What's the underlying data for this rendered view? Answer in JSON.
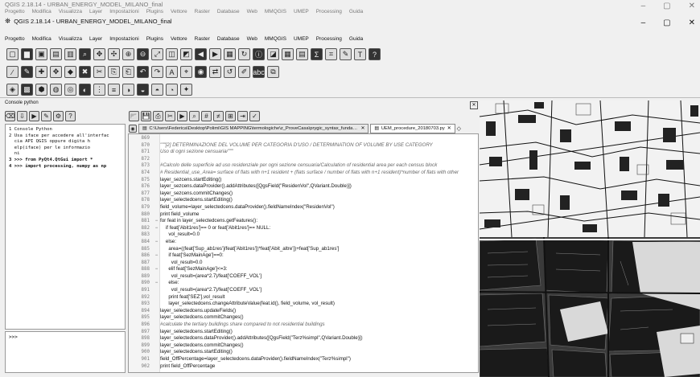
{
  "window": {
    "title": "QGIS 2.18.14 - URBAN_ENERGY_MODEL_MILANO_final",
    "controls": [
      "–",
      "▢",
      "✕"
    ]
  },
  "menubar": [
    "Progetto",
    "Modifica",
    "Visualizza",
    "Layer",
    "Impostazioni",
    "Plugins",
    "Vettore",
    "Raster",
    "Database",
    "Web",
    "MMQGIS",
    "UMEP",
    "Processing",
    "Guida"
  ],
  "console": {
    "title": "Console python",
    "output_lines": [
      "1 Console Python",
      "2 Usa iface per accedere all'interfac",
      "  cia API QGIS oppure digita h",
      "  elp(iface) per le informazio",
      "  ni",
      "3 >>> from PyQt4.QtGui import *",
      "4 >>> import processing, numpy as np"
    ],
    "prompt": ">>>"
  },
  "editor": {
    "tabs": [
      {
        "label": "C:\\Users\\Federica\\Desktop\\Polimi\\GIS MAPPING\\termologiche\\z_ProveCasa\\prygic_syntax_fundamentals.py",
        "active": false
      },
      {
        "label": "UEM_procedure_20180703.py",
        "active": true
      }
    ],
    "lines": [
      {
        "n": "869",
        "f": "",
        "t": "",
        "c": false
      },
      {
        "n": "870",
        "f": "",
        "t": "\"\"\"[2] DETERMINAZIONE DEL VOLUME PER CATEGORIA D'USO / DETERMINATION OF VOLUME BY USE CATEGORY",
        "c": true
      },
      {
        "n": "871",
        "f": "",
        "t": "Uso di ogni sezione censuaria/\"\"\"",
        "c": true
      },
      {
        "n": "872",
        "f": "",
        "t": "",
        "c": false
      },
      {
        "n": "873",
        "f": "",
        "t": "#Calcolo delle superficie ad uso residenziale per ogni sezione censuaria/Calculation of residential area per each census block",
        "c": true
      },
      {
        "n": "874",
        "f": "",
        "t": "# Residential_use_Area= surface of flats with n+1 resident + (flats surface / number of flats with n+1 resident)*number of flats with other",
        "c": true
      },
      {
        "n": "875",
        "f": "",
        "t": "layer_sezcens.startEditing()",
        "c": false
      },
      {
        "n": "876",
        "f": "",
        "t": "layer_sezcens.dataProvider().addAttributes([QgsField(\"ResidenVol\",QVariant.Double)])",
        "c": false
      },
      {
        "n": "877",
        "f": "",
        "t": "layer_sezcens.commitChanges()",
        "c": false
      },
      {
        "n": "878",
        "f": "",
        "t": "layer_selectedcens.startEditing()",
        "c": false
      },
      {
        "n": "879",
        "f": "",
        "t": "field_volume=layer_selectedcens.dataProvider().fieldNameIndex(\"ResidenVol\")",
        "c": false
      },
      {
        "n": "880",
        "f": "",
        "t": "print field_volume",
        "c": false
      },
      {
        "n": "881",
        "f": "−",
        "t": "for feat in layer_selectedcens.getFeatures():",
        "c": false
      },
      {
        "n": "882",
        "f": "−",
        "t": "    if feat['Abit1res']== 0 or feat['Abit1res']== NULL:",
        "c": false
      },
      {
        "n": "883",
        "f": "",
        "t": "      vol_result=0.0",
        "c": false
      },
      {
        "n": "884",
        "f": "−",
        "t": "    else:",
        "c": false
      },
      {
        "n": "885",
        "f": "",
        "t": "      area=((feat['Sup_ab1res']/feat['Abit1res'])*feat['Abit_altre'])+feat['Sup_ab1res']",
        "c": false
      },
      {
        "n": "886",
        "f": "−",
        "t": "      if feat['SezMainAge']==0:",
        "c": false
      },
      {
        "n": "887",
        "f": "",
        "t": "        vol_result=0.0",
        "c": false
      },
      {
        "n": "888",
        "f": "−",
        "t": "      elif feat['SezMainAge']<=3:",
        "c": false
      },
      {
        "n": "889",
        "f": "",
        "t": "        vol_result=(area*2.7)/feat['COEFF_VOL']",
        "c": false
      },
      {
        "n": "890",
        "f": "−",
        "t": "      else:",
        "c": false
      },
      {
        "n": "891",
        "f": "",
        "t": "        vol_result=(area*2.7)/feat['COEFF_VOL']",
        "c": false
      },
      {
        "n": "892",
        "f": "",
        "t": "      print feat['SEZ'],vol_result",
        "c": false
      },
      {
        "n": "893",
        "f": "",
        "t": "      layer_selectedcens.changeAttributeValue(feat.id(), field_volume, vol_result)",
        "c": false
      },
      {
        "n": "894",
        "f": "",
        "t": "layer_selectedcens.updateFields()",
        "c": false
      },
      {
        "n": "895",
        "f": "",
        "t": "layer_selectedcens.commitChanges()",
        "c": false
      },
      {
        "n": "896",
        "f": "",
        "t": "#calculate the tertiary buildings share compared to not residential buildings",
        "c": true
      },
      {
        "n": "897",
        "f": "",
        "t": "layer_selectedcens.startEditing()",
        "c": false
      },
      {
        "n": "898",
        "f": "",
        "t": "layer_selectedcens.dataProvider().addAttributes([QgsField(\"Terz%simpl\",QVariant.Double)])",
        "c": false
      },
      {
        "n": "899",
        "f": "",
        "t": "layer_selectedcens.commitChanges()",
        "c": false
      },
      {
        "n": "900",
        "f": "",
        "t": "layer_selectedcens.startEditing()",
        "c": false
      },
      {
        "n": "901",
        "f": "",
        "t": "field_OffPercentage=layer_selectedcens.dataProvider().fieldNameIndex(\"Terz%simpl\")",
        "c": false
      },
      {
        "n": "902",
        "f": "",
        "t": "print field_OffPercentage",
        "c": false
      }
    ]
  },
  "toolbar_icons": {
    "row1": [
      "new-project",
      "open-project",
      "save-project",
      "save-as",
      "print-layout",
      "composer",
      "pan",
      "pan-to-selection",
      "zoom-in",
      "zoom-out",
      "zoom-full",
      "zoom-layer",
      "zoom-selection",
      "zoom-last",
      "zoom-next",
      "new-map-view",
      "refresh",
      "identify",
      "select",
      "attribute-table",
      "field-calculator",
      "statistics",
      "measure",
      "annotation",
      "text-annotation",
      "help"
    ],
    "row2": [
      "digitize",
      "edit",
      "add-feature",
      "move-feature",
      "node-tool",
      "delete",
      "cut",
      "copy",
      "paste",
      "undo",
      "redo",
      "label",
      "label-pin",
      "label-show",
      "label-move",
      "label-rotate",
      "label-change",
      "abc",
      "python"
    ],
    "row3": [
      "add-vector",
      "add-raster",
      "add-postgis",
      "add-spatialite",
      "add-wms",
      "add-wfs",
      "add-delimited",
      "add-csv",
      "add-wcs",
      "add-oracle",
      "add-mssql",
      "add-virtual",
      "new-shapefile"
    ]
  }
}
